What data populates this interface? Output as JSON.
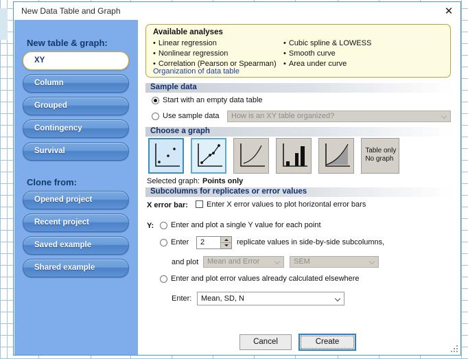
{
  "window": {
    "title": "New Data Table and Graph",
    "close_icon": "close-icon"
  },
  "sidebar": {
    "new_heading": "New table & graph:",
    "new_items": [
      {
        "label": "XY",
        "selected": true
      },
      {
        "label": "Column",
        "selected": false
      },
      {
        "label": "Grouped",
        "selected": false
      },
      {
        "label": "Contingency",
        "selected": false
      },
      {
        "label": "Survival",
        "selected": false
      }
    ],
    "clone_heading": "Clone from:",
    "clone_items": [
      {
        "label": "Opened project"
      },
      {
        "label": "Recent project"
      },
      {
        "label": "Saved example"
      },
      {
        "label": "Shared example"
      }
    ]
  },
  "analyses": {
    "title": "Available analyses",
    "left": [
      "Linear regression",
      "Nonlinear regression",
      "Correlation (Pearson or Spearman)"
    ],
    "right": [
      "Cubic spline & LOWESS",
      "Smooth curve",
      "Area under curve"
    ],
    "link": "Organization of data table"
  },
  "sample_data": {
    "header": "Sample data",
    "option_empty": "Start with an empty data table",
    "option_sample": "Use sample data",
    "selected": "empty",
    "dropdown_value": "How is an XY table organized?",
    "dropdown_disabled": true
  },
  "choose_graph": {
    "header": "Choose a graph",
    "thumbs": [
      {
        "name": "points-only",
        "selected": true
      },
      {
        "name": "points-with-connecting-line",
        "selected": false
      },
      {
        "name": "line-only",
        "selected": false
      },
      {
        "name": "bars",
        "selected": false
      },
      {
        "name": "area-under-curve",
        "selected": false
      },
      {
        "name": "table-only-no-graph",
        "label_line1": "Table only",
        "label_line2": "No graph",
        "selected": false
      }
    ],
    "selected_label": "Selected graph:",
    "selected_value": "Points only"
  },
  "subcolumns": {
    "header": "Subcolumns for replicates or error values",
    "x_error_label": "X error bar:",
    "x_error_checkbox_text": "Enter X error values to plot horizontal error bars",
    "x_error_checked": false,
    "y_label": "Y:",
    "y_option_single": "Enter and plot a single Y value for each point",
    "y_option_enter_prefix": "Enter",
    "y_replicate_count": "2",
    "y_option_enter_suffix": "replicate values in side-by-side subcolumns,",
    "and_plot_label": "and plot",
    "and_plot_value": "Mean and Error",
    "and_plot_error_value": "SEM",
    "and_plot_disabled": true,
    "y_option_precalculated": "Enter and plot error values already calculated elsewhere",
    "enter_label": "Enter:",
    "enter_value": "Mean, SD, N"
  },
  "footer": {
    "cancel_label": "Cancel",
    "create_label": "Create"
  },
  "colors": {
    "sidebar_bg": "#7fadeb",
    "accent_blue": "#10306e",
    "analyses_bg": "#fdfbe0",
    "link": "#1a3fa0",
    "default_btn_border": "#2e7fc0"
  }
}
